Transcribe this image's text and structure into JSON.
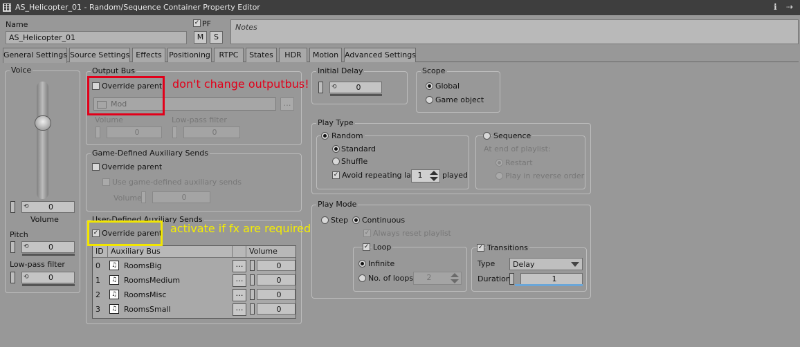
{
  "window": {
    "title": "AS_Helicopter_01 - Random/Sequence Container Property Editor"
  },
  "header": {
    "name_label": "Name",
    "name_value": "AS_Helicopter_01",
    "pf_label": "PF",
    "m_label": "M",
    "s_label": "S",
    "notes_placeholder": "Notes"
  },
  "tabs": [
    "General Settings",
    "Source Settings",
    "Effects",
    "Positioning",
    "RTPC",
    "States",
    "HDR",
    "Motion",
    "Advanced Settings"
  ],
  "voice": {
    "title": "Voice",
    "volume_value": "0",
    "volume_label": "Volume",
    "pitch_label": "Pitch",
    "pitch_value": "0",
    "lpf_label": "Low-pass filter",
    "lpf_value": "0"
  },
  "output_bus": {
    "title": "Output Bus",
    "override_label": "Override parent",
    "bus_name": "Mod",
    "volume_label": "Volume",
    "volume_value": "0",
    "lpf_label": "Low-pass filter",
    "lpf_value": "0"
  },
  "game_aux": {
    "title": "Game-Defined Auxiliary Sends",
    "override_label": "Override parent",
    "use_label": "Use game-defined auxiliary sends",
    "volume_label": "Volume",
    "volume_value": "0"
  },
  "user_aux": {
    "title": "User-Defined Auxiliary Sends",
    "override_label": "Override parent",
    "col_id": "ID",
    "col_bus": "Auxiliary Bus",
    "col_volume": "Volume",
    "rows": [
      {
        "id": "0",
        "bus": "RoomsBig",
        "volume": "0"
      },
      {
        "id": "1",
        "bus": "RoomsMedium",
        "volume": "0"
      },
      {
        "id": "2",
        "bus": "RoomsMisc",
        "volume": "0"
      },
      {
        "id": "3",
        "bus": "RoomsSmall",
        "volume": "0"
      }
    ]
  },
  "annotations": {
    "red": "don't change outputbus!",
    "yellow": "activate if fx are required"
  },
  "initial_delay": {
    "title": "Initial Delay",
    "value": "0"
  },
  "scope": {
    "title": "Scope",
    "global": "Global",
    "game_object": "Game object"
  },
  "play_type": {
    "title": "Play Type",
    "random": "Random",
    "standard": "Standard",
    "shuffle": "Shuffle",
    "avoid_label": "Avoid repeating last",
    "avoid_value": "1",
    "played": "played",
    "sequence": "Sequence",
    "end_label": "At end of playlist:",
    "restart": "Restart",
    "reverse": "Play in reverse order"
  },
  "play_mode": {
    "title": "Play Mode",
    "step": "Step",
    "continuous": "Continuous",
    "always_reset": "Always reset playlist",
    "loop": "Loop",
    "infinite": "Infinite",
    "no_loops": "No. of loops",
    "loops_value": "2",
    "transitions": "Transitions",
    "type_label": "Type",
    "type_value": "Delay",
    "duration_label": "Duration",
    "duration_value": "1"
  }
}
